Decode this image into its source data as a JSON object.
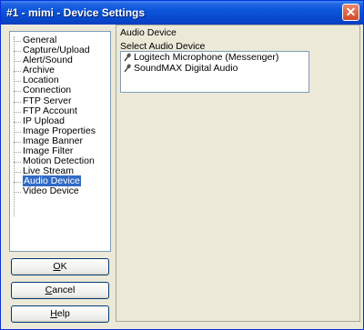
{
  "window": {
    "title": "#1 - mimi - Device Settings",
    "close_glyph": "✕"
  },
  "tree": {
    "items": [
      {
        "label": "General",
        "selected": false
      },
      {
        "label": "Capture/Upload",
        "selected": false
      },
      {
        "label": "Alert/Sound",
        "selected": false
      },
      {
        "label": "Archive",
        "selected": false
      },
      {
        "label": "Location",
        "selected": false
      },
      {
        "label": "Connection",
        "selected": false
      },
      {
        "label": "FTP Server",
        "selected": false
      },
      {
        "label": "FTP Account",
        "selected": false
      },
      {
        "label": "IP Upload",
        "selected": false
      },
      {
        "label": "Image Properties",
        "selected": false
      },
      {
        "label": "Image Banner",
        "selected": false
      },
      {
        "label": "Image Filter",
        "selected": false
      },
      {
        "label": "Motion Detection",
        "selected": false
      },
      {
        "label": "Live Stream",
        "selected": false
      },
      {
        "label": "Audio Device",
        "selected": true
      },
      {
        "label": "Video Device",
        "selected": false
      }
    ]
  },
  "buttons": {
    "ok": {
      "hotkey": "O",
      "rest": "K"
    },
    "cancel": {
      "hotkey": "C",
      "rest": "ancel"
    },
    "help": {
      "hotkey": "H",
      "rest": "elp"
    }
  },
  "panel": {
    "title": "Audio Device",
    "select_label": "Select Audio Device",
    "devices": [
      {
        "label": "Logitech Microphone (Messenger)",
        "icon": "microphone-icon"
      },
      {
        "label": "SoundMAX Digital Audio",
        "icon": "microphone-icon"
      }
    ]
  },
  "colors": {
    "selection": "#316ac5",
    "titlebar": "#0a55db",
    "dialog_bg": "#ece9d8"
  }
}
